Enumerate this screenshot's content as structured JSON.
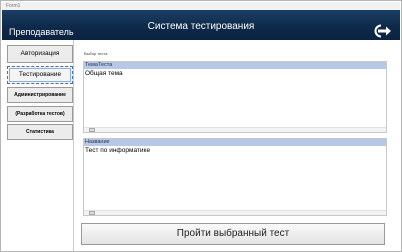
{
  "window": {
    "title": "Form1"
  },
  "header": {
    "role": "Преподаватель",
    "title": "Система тестирования",
    "logout_icon": "logout-icon"
  },
  "sidebar": {
    "items": [
      {
        "label": "Авторизация",
        "active": false
      },
      {
        "label": "Тестирование",
        "active": true
      },
      {
        "label": "Администрирование",
        "active": false
      },
      {
        "label": "(Разработка тестов)",
        "active": false
      },
      {
        "label": "Статистика",
        "active": false
      }
    ]
  },
  "main": {
    "caption": "Выбор теста",
    "topics_grid": {
      "header": "ТемаТеста",
      "rows": [
        "Общая тема"
      ]
    },
    "tests_grid": {
      "header": "Название",
      "rows": [
        "Тест по информатике"
      ]
    },
    "run_button_label": "Пройти выбранный тест"
  },
  "colors": {
    "header_bg": "#0e2a4a",
    "grid_header_bg": "#b6c8e6"
  }
}
